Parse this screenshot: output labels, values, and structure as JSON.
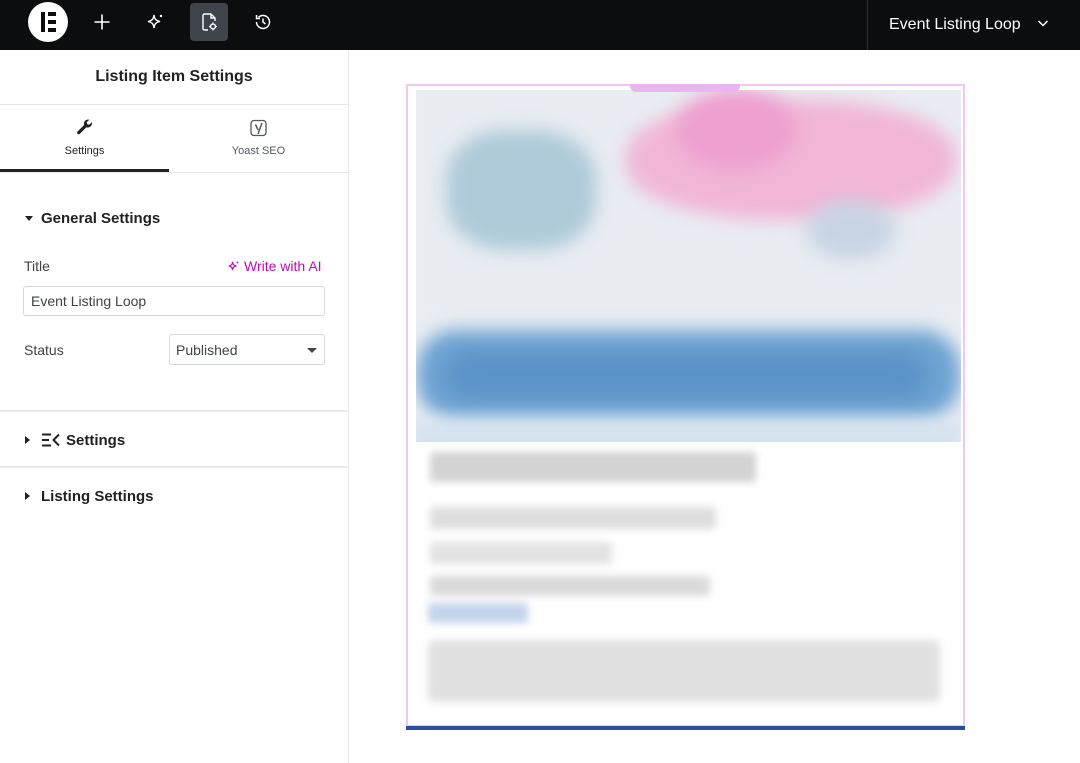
{
  "topbar": {
    "document_title": "Event Listing Loop",
    "icons": [
      "elementor-logo",
      "plus-icon",
      "sparkle-ai-icon",
      "page-settings-icon",
      "history-icon"
    ]
  },
  "panel": {
    "title": "Listing Item Settings",
    "tabs": [
      {
        "label": "Settings",
        "icon": "wrench-icon",
        "active": true
      },
      {
        "label": "Yoast SEO",
        "icon": "yoast-icon",
        "active": false
      }
    ],
    "general_settings": {
      "heading": "General Settings",
      "title_label": "Title",
      "write_with_ai": "Write with AI",
      "title_value": "Event Listing Loop",
      "status_label": "Status",
      "status_value": "Published"
    },
    "sections": [
      {
        "label": "Settings",
        "icon": "jetengine-icon"
      },
      {
        "label": "Listing Settings"
      }
    ]
  },
  "colors": {
    "accent_ai": "#c00bb9",
    "topbar_bg": "#0c0d0e",
    "card_border": "#f0c6f2",
    "card_bottom": "#2d4fa0"
  }
}
